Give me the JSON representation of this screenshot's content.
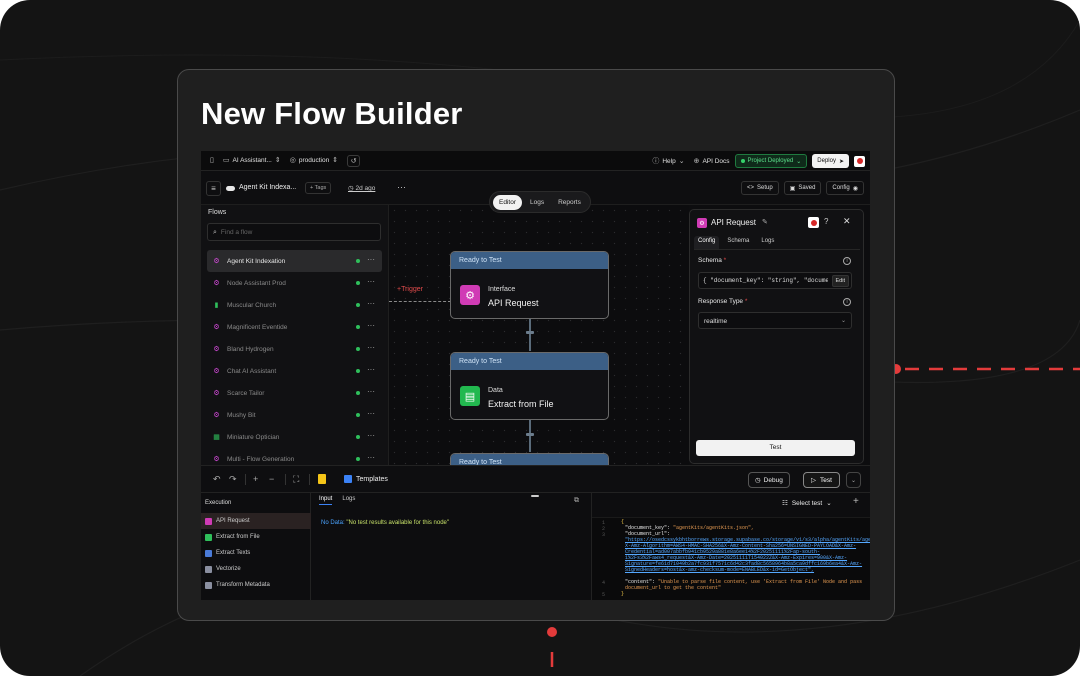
{
  "hero_title": "New Flow Builder",
  "topbar": {
    "project": "AI Assistant...",
    "env": "production",
    "help": "Help",
    "api_docs": "API Docs",
    "status": "Project Deployed",
    "deploy": "Deploy"
  },
  "bar2": {
    "flow_name": "Agent Kit Indexa...",
    "tags": "+ Tags",
    "ago": "2d ago",
    "more": "···",
    "setup": "Setup",
    "saved": "Saved",
    "config": "Config"
  },
  "center_tabs": {
    "editor": "Editor",
    "logs": "Logs",
    "reports": "Reports"
  },
  "sidebar": {
    "title": "Flows",
    "search_placeholder": "Find a flow",
    "items": [
      {
        "label": "Agent Kit Indexation",
        "glyph": "⚙"
      },
      {
        "label": "Node Assistant Prod",
        "glyph": "⚙"
      },
      {
        "label": "Muscular Church",
        "glyph": "▮"
      },
      {
        "label": "Magnificent Eventide",
        "glyph": "⚙"
      },
      {
        "label": "Bland Hydrogen",
        "glyph": "⚙"
      },
      {
        "label": "Chat AI Assistant",
        "glyph": "⚙"
      },
      {
        "label": "Scarce Tailor",
        "glyph": "⚙"
      },
      {
        "label": "Mushy Bit",
        "glyph": "⚙"
      },
      {
        "label": "Miniature Optician",
        "glyph": "▦"
      },
      {
        "label": "Multi - Flow Generation",
        "glyph": "⚙"
      }
    ],
    "item_more": "···"
  },
  "canvas": {
    "trigger": "+Trigger",
    "nodes": [
      {
        "status": "Ready to Test",
        "type": "Interface",
        "name": "API Request",
        "icon": "⚙"
      },
      {
        "status": "Ready to Test",
        "type": "Data",
        "name": "Extract from File",
        "icon": "▤"
      },
      {
        "status": "Ready to Test"
      }
    ]
  },
  "panel": {
    "title": "API Request",
    "tabs": {
      "config": "Config",
      "schema": "Schema",
      "logs": "Logs"
    },
    "schema_label": "Schema",
    "required": "*",
    "schema_value": "{ \"document_key\": \"string\", \"document_",
    "edit": "Edit",
    "response_label": "Response Type",
    "response_value": "realtime",
    "test": "Test"
  },
  "toolbar": {
    "templates": "Templates",
    "debug": "Debug",
    "test": "Test"
  },
  "execution": {
    "title": "Execution",
    "items": [
      {
        "label": "API Request"
      },
      {
        "label": "Extract from File"
      },
      {
        "label": "Extract Texts"
      },
      {
        "label": "Vectorize"
      },
      {
        "label": "Transform Metadata"
      }
    ]
  },
  "io": {
    "input_tab": "Input",
    "logs_tab": "Logs",
    "no_data_label": "No Data:",
    "no_data_msg": "\"No test results available for this node\""
  },
  "json_view": {
    "select": "Select test",
    "line_numbers": [
      "1",
      "2",
      "3",
      "",
      "",
      "",
      "",
      "",
      "",
      "",
      "4",
      "",
      "5"
    ],
    "open_brace": "{",
    "close_brace": "}",
    "doc_key_k": "\"document_key\":",
    "doc_key_v": "\"agentKits/agentKits.json\",",
    "doc_url_k": "\"document_url\":",
    "doc_url_v": "\"https://osedcssykbhtborrews.storage.supabase.co/storage/v1/s3/alpha/agentKits/agentKits.json?X-Amz-Algorithm=AWS4-HMAC-SHA256&X-Amz-Content-Sha256=UNSIGNED-PAYLOAD&X-Amz-Credential=ad007abbfb941cb9529a881e8a6ee14%2F20251111%2Fap-south-1%2Fs3%2Faws4_request&X-Amz-Date=20251111T154022Z&X-Amz-Expires=900&X-Amz-Signature=fe61d71049b2a7fc931f7571c6d42c3fad8c5658964b8a5ca9dffc169b6ea4&X-Amz-SignedHeaders=host&x-amz-checksum-mode=ENABLED&x-id=GetObject\",",
    "content_k": "\"content\":",
    "content_v": "\"Unable to parse file content, use 'Extract from File' Node and pass document_url to get the content\""
  }
}
